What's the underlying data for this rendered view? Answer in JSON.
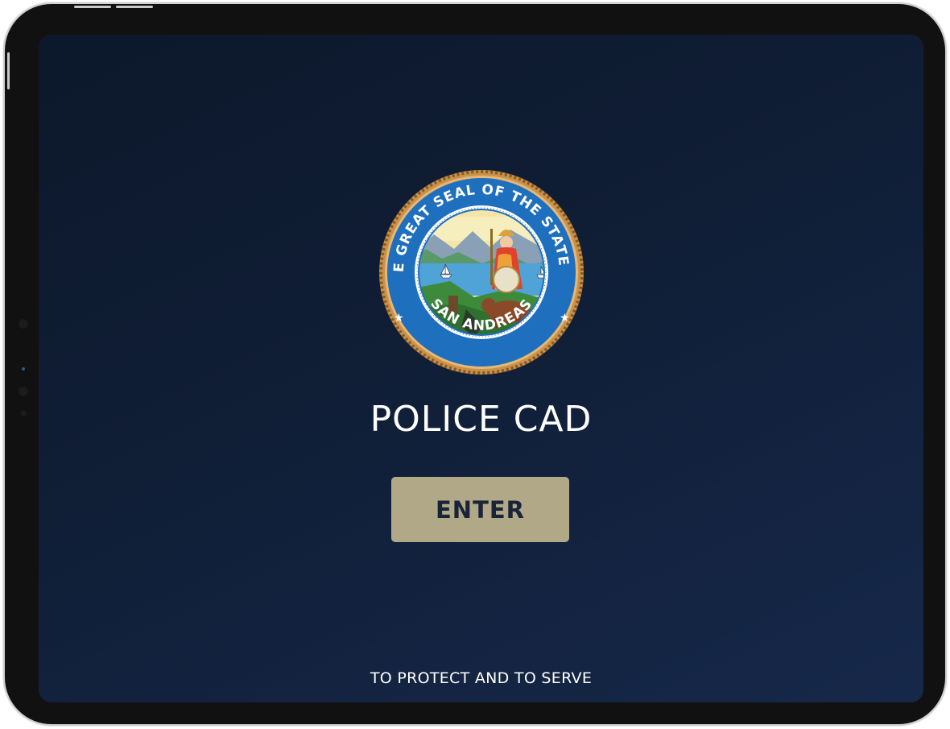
{
  "app": {
    "title": "POLICE CAD",
    "enter_label": "ENTER",
    "motto": "TO PROTECT AND TO SERVE"
  },
  "seal": {
    "text_top": "THE GREAT SEAL OF THE STATE OF",
    "text_bottom": "SAN ANDREAS"
  },
  "colors": {
    "background": "#101e36",
    "button": "#b1a888",
    "button_text": "#1a2438",
    "seal_ring": "#1f6fbf",
    "seal_rope": "#c8924a"
  },
  "icons": [
    "state-seal-icon"
  ]
}
